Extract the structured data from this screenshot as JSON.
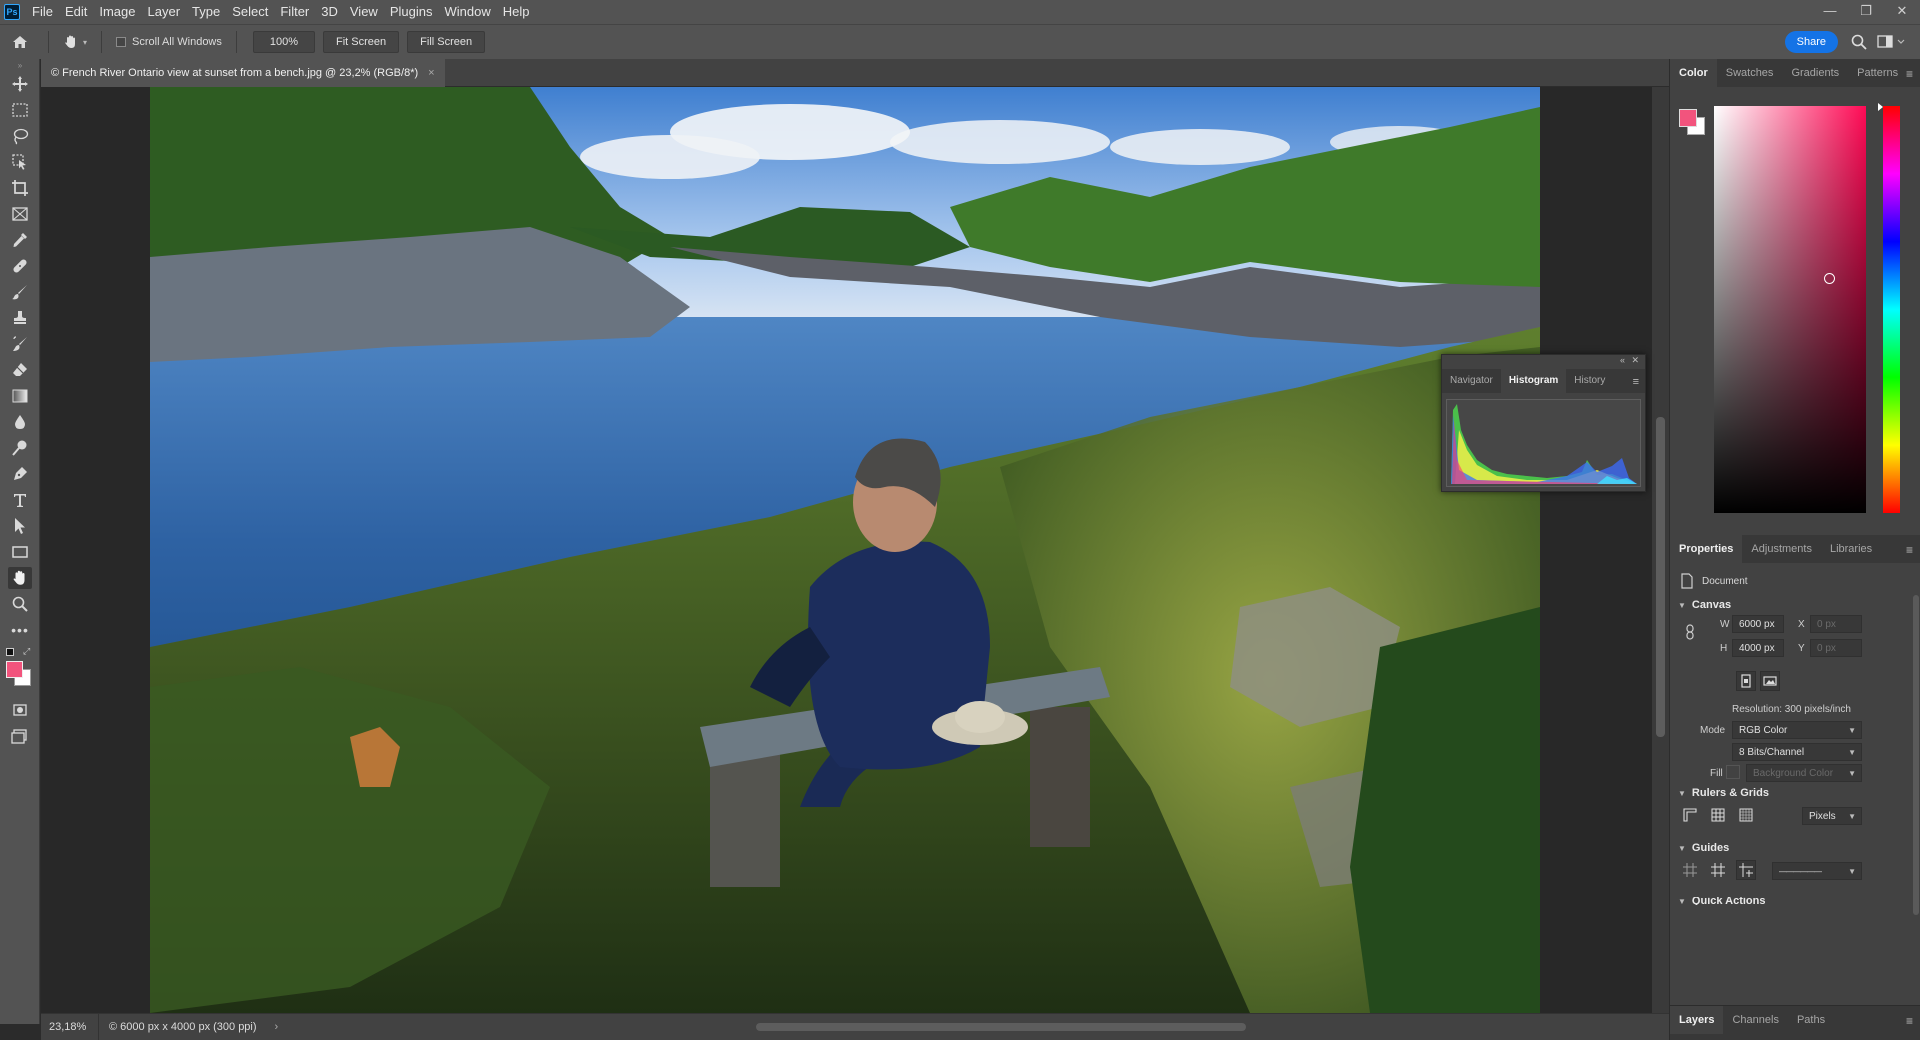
{
  "app": {
    "logo": "Ps",
    "menu": [
      "File",
      "Edit",
      "Image",
      "Layer",
      "Type",
      "Select",
      "Filter",
      "3D",
      "View",
      "Plugins",
      "Window",
      "Help"
    ],
    "window_controls": [
      "—",
      "❐",
      "✕"
    ]
  },
  "options_bar": {
    "scroll_all_windows": "Scroll All Windows",
    "zoom_100": "100%",
    "fit_screen": "Fit Screen",
    "fill_screen": "Fill Screen",
    "share": "Share"
  },
  "document": {
    "tab_title": "© French River Ontario view at sunset from a bench.jpg @ 23,2% (RGB/8*)",
    "close": "×",
    "zoom": "23,18%",
    "info": "© 6000 px x 4000 px (300 ppi)",
    "info_arrow": "›"
  },
  "float_panel": {
    "tabs": [
      "Navigator",
      "Histogram",
      "History"
    ],
    "active_tab": "Histogram",
    "collapse": "«",
    "close": "✕",
    "menu": "≡"
  },
  "color_panel": {
    "tabs": [
      "Color",
      "Swatches",
      "Gradients",
      "Patterns"
    ],
    "active_tab": "Color",
    "menu": "≡",
    "foreground": "#f2547d",
    "background": "#ffffff"
  },
  "properties_panel": {
    "tabs": [
      "Properties",
      "Adjustments",
      "Libraries"
    ],
    "active_tab": "Properties",
    "menu": "≡",
    "document_label": "Document",
    "canvas": {
      "title": "Canvas",
      "w_label": "W",
      "w_value": "6000 px",
      "h_label": "H",
      "h_value": "4000 px",
      "x_label": "X",
      "x_value": "0 px",
      "y_label": "Y",
      "y_value": "0 px",
      "resolution": "Resolution: 300 pixels/inch",
      "mode_label": "Mode",
      "mode_value": "RGB Color",
      "bits_value": "8 Bits/Channel",
      "fill_label": "Fill",
      "fill_value": "Background Color"
    },
    "rulers_grids": {
      "title": "Rulers & Grids",
      "units": "Pixels"
    },
    "guides": {
      "title": "Guides",
      "line_style": "——————"
    },
    "quick_actions": {
      "title": "Quick Actions"
    }
  },
  "layers_panel": {
    "tabs": [
      "Layers",
      "Channels",
      "Paths"
    ],
    "active_tab": "Layers",
    "menu": "≡"
  }
}
